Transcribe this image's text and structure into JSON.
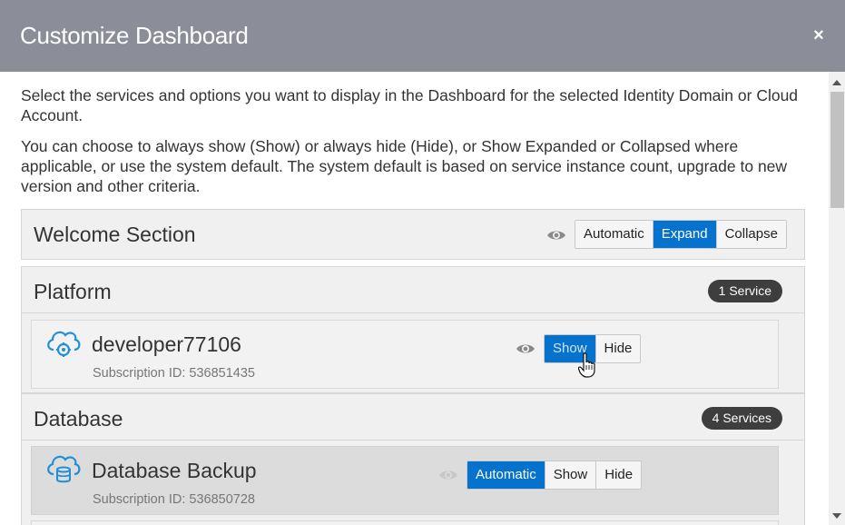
{
  "dialog": {
    "title": "Customize Dashboard",
    "close_icon": "×"
  },
  "intro": {
    "paragraph1": "Select the services and options you want to display in the Dashboard for the selected Identity Domain or Cloud Account.",
    "paragraph2": "You can choose to always show (Show) or always hide (Hide), or Show Expanded or Collapsed where applicable, or use the system default. The system default is based on service instance count, upgrade to new version and other criteria."
  },
  "welcome": {
    "title": "Welcome Section",
    "options": [
      "Automatic",
      "Expand",
      "Collapse"
    ],
    "selected": "Expand"
  },
  "platform": {
    "title": "Platform",
    "badge": "1 Service",
    "services": [
      {
        "name": "developer77106",
        "subscription": "Subscription ID: 536851435",
        "options": [
          "Show",
          "Hide"
        ],
        "selected": "Show",
        "icon": "cloud-gear-icon"
      }
    ]
  },
  "database": {
    "title": "Database",
    "badge": "4 Services",
    "services": [
      {
        "name": "Database Backup",
        "subscription": "Subscription ID: 536850728",
        "options": [
          "Automatic",
          "Show",
          "Hide"
        ],
        "selected": "Automatic",
        "icon": "cloud-database-icon"
      }
    ]
  },
  "colors": {
    "header_bg": "#8b8d98",
    "accent": "#0572ce",
    "badge_bg": "#3e3e3e"
  }
}
